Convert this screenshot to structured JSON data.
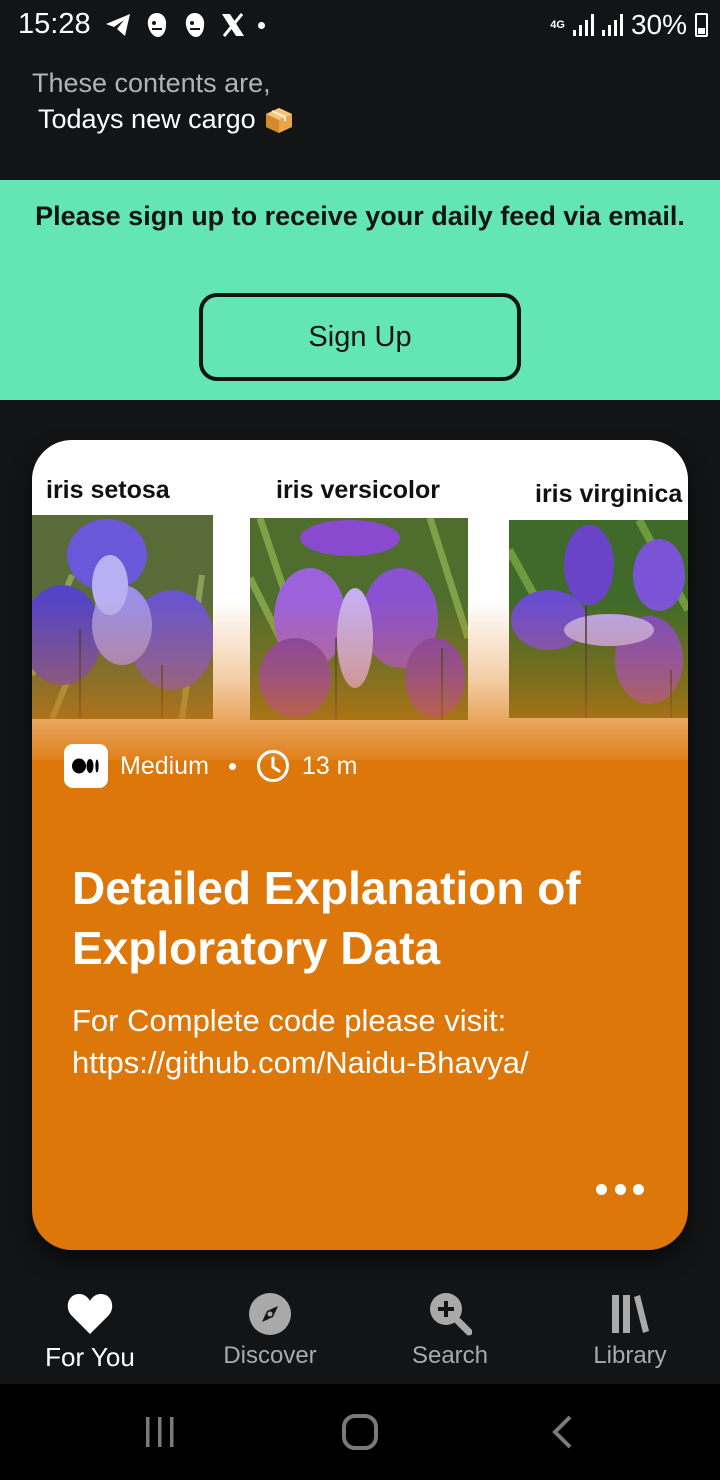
{
  "status_bar": {
    "time": "15:28",
    "network": "4G",
    "battery": "30%"
  },
  "header": {
    "subtitle": "These contents are,",
    "title": "Todays new cargo"
  },
  "banner": {
    "message": "Please sign up to receive your daily feed via email.",
    "button_label": "Sign Up",
    "background": "#63e6b4"
  },
  "card": {
    "background": "#dd770a",
    "image_labels": [
      "iris setosa",
      "iris versicolor",
      "iris virginica"
    ],
    "source": "Medium",
    "read_time": "13 m",
    "title": "Detailed Explanation of Exploratory Data",
    "description": "For Complete code please visit: https://github.com/Naidu-Bhavya/"
  },
  "bottom_nav": {
    "items": [
      {
        "label": "For You",
        "icon": "heart-icon",
        "active": true
      },
      {
        "label": "Discover",
        "icon": "compass-icon",
        "active": false
      },
      {
        "label": "Search",
        "icon": "search-plus-icon",
        "active": false
      },
      {
        "label": "Library",
        "icon": "library-icon",
        "active": false
      }
    ]
  }
}
